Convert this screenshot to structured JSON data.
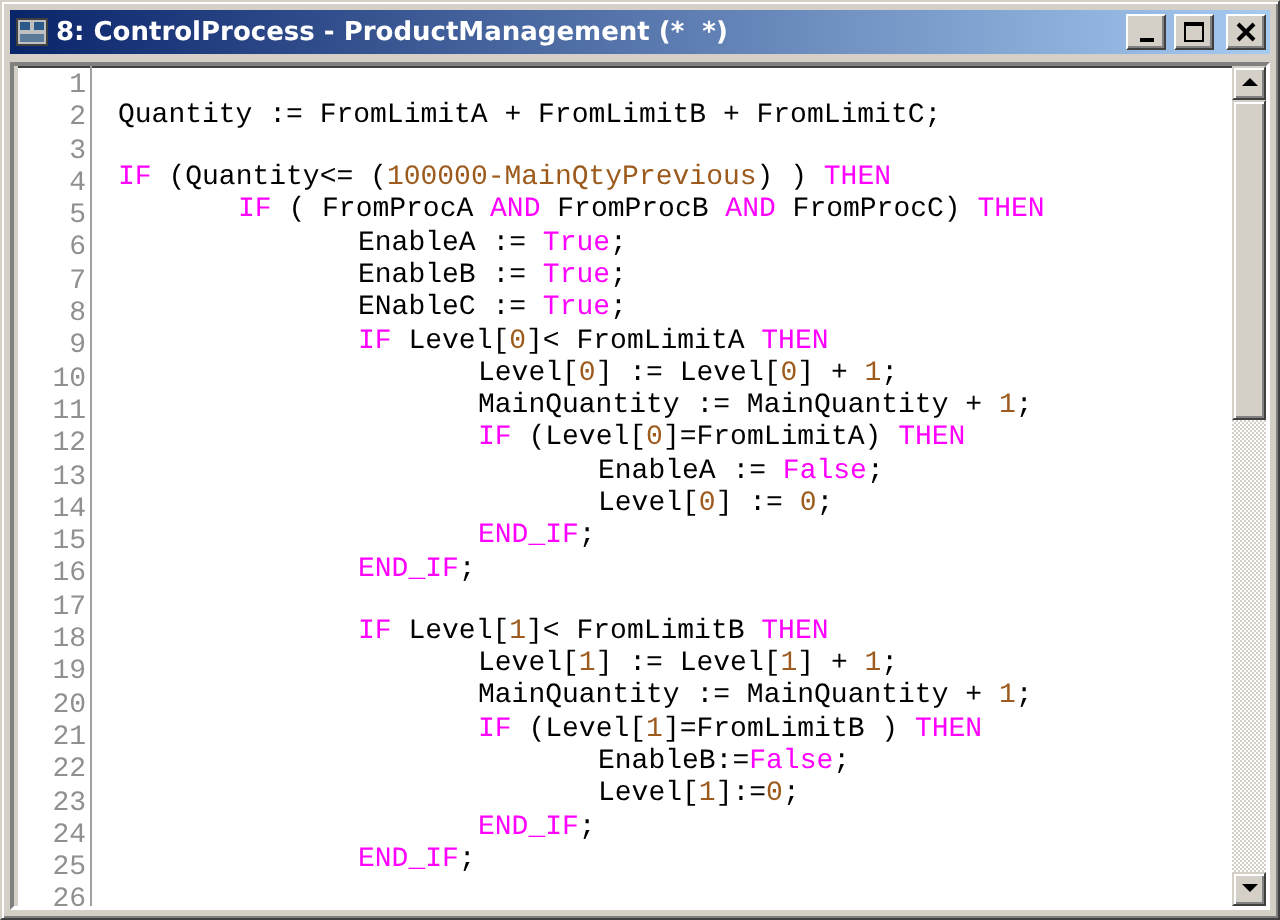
{
  "window": {
    "title": "8: ControlProcess - ProductManagement (*  *)"
  },
  "editor": {
    "lines": [
      {
        "number": "1"
      },
      {
        "number": "2",
        "tokens": [
          {
            "kind": "plain",
            "text": "Quantity := FromLimitA + FromLimitB + FromLimitC;"
          }
        ]
      },
      {
        "number": "3"
      },
      {
        "number": "4",
        "tokens": [
          {
            "kind": "keyword",
            "text": "IF"
          },
          {
            "kind": "plain",
            "text": " (Quantity<= ("
          },
          {
            "kind": "number",
            "text": "100000-MainQtyPrevious"
          },
          {
            "kind": "plain",
            "text": ") ) "
          },
          {
            "kind": "keyword",
            "text": "THEN"
          }
        ]
      },
      {
        "number": "5",
        "tokens": [
          {
            "kind": "keyword",
            "text": "\tIF"
          },
          {
            "kind": "plain",
            "text": " ( FromProcA "
          },
          {
            "kind": "keyword",
            "text": "AND"
          },
          {
            "kind": "plain",
            "text": " FromProcB "
          },
          {
            "kind": "keyword",
            "text": "AND"
          },
          {
            "kind": "plain",
            "text": " FromProcC) "
          },
          {
            "kind": "keyword",
            "text": "THEN"
          }
        ]
      },
      {
        "number": "6",
        "tokens": [
          {
            "kind": "plain",
            "text": "\t\tEnableA := "
          },
          {
            "kind": "keyword",
            "text": "True"
          },
          {
            "kind": "plain",
            "text": ";"
          }
        ]
      },
      {
        "number": "7",
        "tokens": [
          {
            "kind": "plain",
            "text": "\t\tEnableB := "
          },
          {
            "kind": "keyword",
            "text": "True"
          },
          {
            "kind": "plain",
            "text": ";"
          }
        ]
      },
      {
        "number": "8",
        "tokens": [
          {
            "kind": "plain",
            "text": "\t\tENableC := "
          },
          {
            "kind": "keyword",
            "text": "True"
          },
          {
            "kind": "plain",
            "text": ";"
          }
        ]
      },
      {
        "number": "9",
        "tokens": [
          {
            "kind": "keyword",
            "text": "\t\tIF"
          },
          {
            "kind": "plain",
            "text": " Level["
          },
          {
            "kind": "number",
            "text": "0"
          },
          {
            "kind": "plain",
            "text": "]< FromLimitA "
          },
          {
            "kind": "keyword",
            "text": "THEN"
          }
        ]
      },
      {
        "number": "10",
        "tokens": [
          {
            "kind": "plain",
            "text": "\t\t\tLevel["
          },
          {
            "kind": "number",
            "text": "0"
          },
          {
            "kind": "plain",
            "text": "] := Level["
          },
          {
            "kind": "number",
            "text": "0"
          },
          {
            "kind": "plain",
            "text": "] + "
          },
          {
            "kind": "number",
            "text": "1"
          },
          {
            "kind": "plain",
            "text": ";"
          }
        ]
      },
      {
        "number": "11",
        "tokens": [
          {
            "kind": "plain",
            "text": "\t\t\tMainQuantity := MainQuantity + "
          },
          {
            "kind": "number",
            "text": "1"
          },
          {
            "kind": "plain",
            "text": ";"
          }
        ]
      },
      {
        "number": "12",
        "tokens": [
          {
            "kind": "keyword",
            "text": "\t\t\tIF"
          },
          {
            "kind": "plain",
            "text": " (Level["
          },
          {
            "kind": "number",
            "text": "0"
          },
          {
            "kind": "plain",
            "text": "]=FromLimitA) "
          },
          {
            "kind": "keyword",
            "text": "THEN"
          }
        ]
      },
      {
        "number": "13",
        "tokens": [
          {
            "kind": "plain",
            "text": "\t\t\t\tEnableA := "
          },
          {
            "kind": "keyword",
            "text": "False"
          },
          {
            "kind": "plain",
            "text": ";"
          }
        ]
      },
      {
        "number": "14",
        "tokens": [
          {
            "kind": "plain",
            "text": "\t\t\t\tLevel["
          },
          {
            "kind": "number",
            "text": "0"
          },
          {
            "kind": "plain",
            "text": "] := "
          },
          {
            "kind": "number",
            "text": "0"
          },
          {
            "kind": "plain",
            "text": ";"
          }
        ]
      },
      {
        "number": "15",
        "tokens": [
          {
            "kind": "keyword",
            "text": "\t\t\tEND_IF"
          },
          {
            "kind": "plain",
            "text": ";"
          }
        ]
      },
      {
        "number": "16",
        "tokens": [
          {
            "kind": "keyword",
            "text": "\t\tEND_IF"
          },
          {
            "kind": "plain",
            "text": ";"
          }
        ]
      },
      {
        "number": "17"
      },
      {
        "number": "18",
        "tokens": [
          {
            "kind": "keyword",
            "text": "\t\tIF"
          },
          {
            "kind": "plain",
            "text": " Level["
          },
          {
            "kind": "number",
            "text": "1"
          },
          {
            "kind": "plain",
            "text": "]< FromLimitB "
          },
          {
            "kind": "keyword",
            "text": "THEN"
          }
        ]
      },
      {
        "number": "19",
        "tokens": [
          {
            "kind": "plain",
            "text": "\t\t\tLevel["
          },
          {
            "kind": "number",
            "text": "1"
          },
          {
            "kind": "plain",
            "text": "] := Level["
          },
          {
            "kind": "number",
            "text": "1"
          },
          {
            "kind": "plain",
            "text": "] + "
          },
          {
            "kind": "number",
            "text": "1"
          },
          {
            "kind": "plain",
            "text": ";"
          }
        ]
      },
      {
        "number": "20",
        "tokens": [
          {
            "kind": "plain",
            "text": "\t\t\tMainQuantity := MainQuantity + "
          },
          {
            "kind": "number",
            "text": "1"
          },
          {
            "kind": "plain",
            "text": ";"
          }
        ]
      },
      {
        "number": "21",
        "tokens": [
          {
            "kind": "keyword",
            "text": "\t\t\tIF"
          },
          {
            "kind": "plain",
            "text": " (Level["
          },
          {
            "kind": "number",
            "text": "1"
          },
          {
            "kind": "plain",
            "text": "]=FromLimitB ) "
          },
          {
            "kind": "keyword",
            "text": "THEN"
          }
        ]
      },
      {
        "number": "22",
        "tokens": [
          {
            "kind": "plain",
            "text": "\t\t\t\tEnableB:="
          },
          {
            "kind": "keyword",
            "text": "False"
          },
          {
            "kind": "plain",
            "text": ";"
          }
        ]
      },
      {
        "number": "23",
        "tokens": [
          {
            "kind": "plain",
            "text": "\t\t\t\tLevel["
          },
          {
            "kind": "number",
            "text": "1"
          },
          {
            "kind": "plain",
            "text": "]:="
          },
          {
            "kind": "number",
            "text": "0"
          },
          {
            "kind": "plain",
            "text": ";"
          }
        ]
      },
      {
        "number": "24",
        "tokens": [
          {
            "kind": "keyword",
            "text": "\t\t\tEND_IF"
          },
          {
            "kind": "plain",
            "text": ";"
          }
        ]
      },
      {
        "number": "25",
        "tokens": [
          {
            "kind": "keyword",
            "text": "\t\tEND_IF"
          },
          {
            "kind": "plain",
            "text": ";"
          }
        ]
      },
      {
        "number": "26"
      }
    ]
  }
}
